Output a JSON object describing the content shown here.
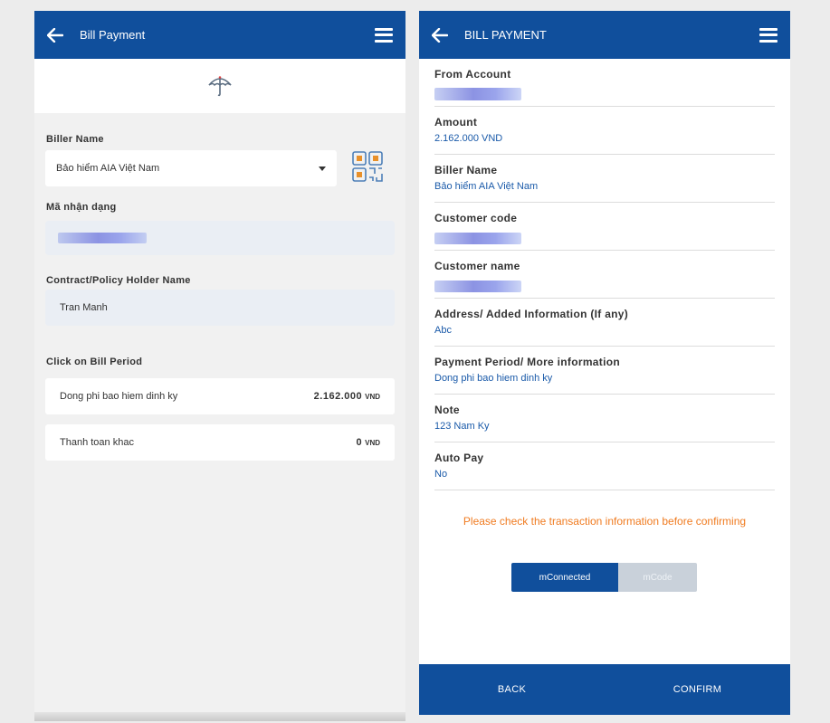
{
  "left": {
    "header": {
      "title": "Bill Payment"
    },
    "biller": {
      "label": "Biller Name",
      "value": "Bảo hiểm AIA Việt Nam"
    },
    "identifier": {
      "label": "Mã nhận dạng"
    },
    "holder": {
      "label": "Contract/Policy Holder Name",
      "value": "Tran Manh"
    },
    "period": {
      "label": "Click on Bill Period",
      "items": [
        {
          "name": "Dong phi bao hiem dinh ky",
          "amount": "2.162.000",
          "currency": "VND"
        },
        {
          "name": "Thanh toan khac",
          "amount": "0",
          "currency": "VND"
        }
      ]
    }
  },
  "right": {
    "header": {
      "title": "BILL PAYMENT"
    },
    "fields": {
      "from_account": {
        "label": "From Account"
      },
      "amount": {
        "label": "Amount",
        "value": "2.162.000 VND"
      },
      "biller": {
        "label": "Biller Name",
        "value": "Bảo hiểm AIA Việt Nam"
      },
      "customer_code": {
        "label": "Customer code"
      },
      "customer_name": {
        "label": "Customer name"
      },
      "address": {
        "label": "Address/ Added Information (If any)",
        "value": "Abc"
      },
      "period": {
        "label": "Payment Period/ More information",
        "value": "Dong phi bao hiem dinh ky"
      },
      "note": {
        "label": "Note",
        "value": "123 Nam Ky"
      },
      "auto_pay": {
        "label": "Auto Pay",
        "value": "No"
      }
    },
    "warning": "Please check the transaction information before confirming",
    "auth_toggle": {
      "options": [
        "mConnected",
        "mCode"
      ],
      "selected": "mConnected"
    },
    "footer": {
      "back": "BACK",
      "confirm": "CONFIRM"
    }
  },
  "colors": {
    "primary": "#104f9c",
    "link": "#1a5aa9",
    "warning": "#f07b20",
    "mask": "#8c93e3"
  }
}
